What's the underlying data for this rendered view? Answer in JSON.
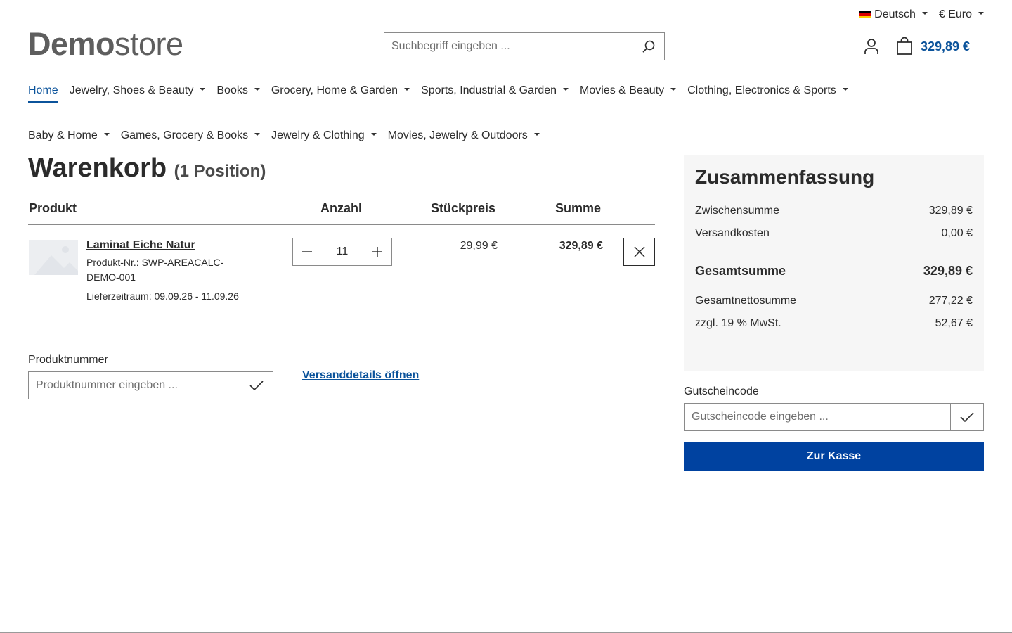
{
  "topbar": {
    "language": "Deutsch",
    "currency": "€ Euro",
    "flag_colors": [
      "#000000",
      "#dd0000",
      "#ffce00"
    ]
  },
  "header": {
    "logo_bold": "Demo",
    "logo_light": "store",
    "search_placeholder": "Suchbegriff eingeben ...",
    "cart_total": "329,89 €"
  },
  "nav": {
    "items": [
      {
        "label": "Home",
        "active": true
      },
      {
        "label": "Jewelry, Shoes & Beauty"
      },
      {
        "label": "Books"
      },
      {
        "label": "Grocery, Home & Garden"
      },
      {
        "label": "Sports, Industrial & Garden"
      },
      {
        "label": "Movies & Beauty"
      },
      {
        "label": "Clothing, Electronics & Sports"
      },
      {
        "label": "Baby & Home"
      },
      {
        "label": "Games, Grocery & Books"
      },
      {
        "label": "Jewelry & Clothing"
      },
      {
        "label": "Movies, Jewelry & Outdoors"
      }
    ]
  },
  "cart": {
    "title": "Warenkorb",
    "count": "(1 Position)",
    "headers": {
      "product": "Produkt",
      "quantity": "Anzahl",
      "unit_price": "Stückpreis",
      "sum": "Summe"
    },
    "item": {
      "name": "Laminat Eiche Natur",
      "number": "Produkt-Nr.: SWP-AREACALC-DEMO-001",
      "delivery": "Lieferzeitraum: 09.09.26 - 11.09.26",
      "quantity": "11",
      "unit_price": "29,99 €",
      "sum": "329,89 €"
    },
    "product_number_label": "Produktnummer",
    "product_number_placeholder": "Produktnummer eingeben ...",
    "shipping_link": "Versanddetails öffnen"
  },
  "summary": {
    "title": "Zusammenfassung",
    "subtotal_label": "Zwischensumme",
    "subtotal": "329,89 €",
    "shipping_label": "Versandkosten",
    "shipping": "0,00 €",
    "total_label": "Gesamtsumme",
    "total": "329,89 €",
    "net_label": "Gesamtnettosumme",
    "net": "277,22 €",
    "tax_label": "zzgl. 19 % MwSt.",
    "tax": "52,67 €",
    "voucher_label": "Gutscheincode",
    "voucher_placeholder": "Gutscheincode eingeben ...",
    "checkout_label": "Zur Kasse",
    "accent": "#0042a0"
  }
}
